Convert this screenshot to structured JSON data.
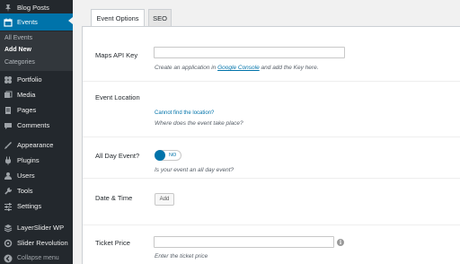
{
  "sidebar": {
    "items": [
      {
        "label": "Blog Posts",
        "icon": "pushpin-icon"
      },
      {
        "label": "Events",
        "icon": "calendar-icon",
        "active": true
      },
      {
        "label": "Portfolio",
        "icon": "portfolio-icon"
      },
      {
        "label": "Media",
        "icon": "media-icon"
      },
      {
        "label": "Pages",
        "icon": "pages-icon"
      },
      {
        "label": "Comments",
        "icon": "comments-icon"
      },
      {
        "label": "Appearance",
        "icon": "appearance-icon"
      },
      {
        "label": "Plugins",
        "icon": "plugins-icon"
      },
      {
        "label": "Users",
        "icon": "users-icon"
      },
      {
        "label": "Tools",
        "icon": "tools-icon"
      },
      {
        "label": "Settings",
        "icon": "settings-icon"
      },
      {
        "label": "LayerSlider WP",
        "icon": "layerslider-icon"
      },
      {
        "label": "Slider Revolution",
        "icon": "slider-revolution-icon"
      }
    ],
    "submenu": [
      "All Events",
      "Add New",
      "Categories"
    ],
    "current_submenu": "Add New",
    "collapse_label": "Collapse menu"
  },
  "tabs": [
    "Event Options",
    "SEO"
  ],
  "fields": {
    "maps_api_key": {
      "label": "Maps API Key",
      "value": "",
      "desc_prefix": "Create an application in ",
      "desc_link": "Google Console",
      "desc_suffix": " and add the Key here."
    },
    "event_location": {
      "label": "Event Location",
      "link": "Cannot find the location?",
      "desc": "Where does the event take place?"
    },
    "all_day": {
      "label": "All Day Event?",
      "toggle_text": "NO",
      "desc": "Is your event an all day event?"
    },
    "date_time": {
      "label": "Date & Time",
      "button": "Add"
    },
    "ticket_price": {
      "label": "Ticket Price",
      "value": "",
      "desc": "Enter the ticket price"
    }
  },
  "colors": {
    "sidebar_bg": "#23282d",
    "accent": "#0073aa"
  }
}
